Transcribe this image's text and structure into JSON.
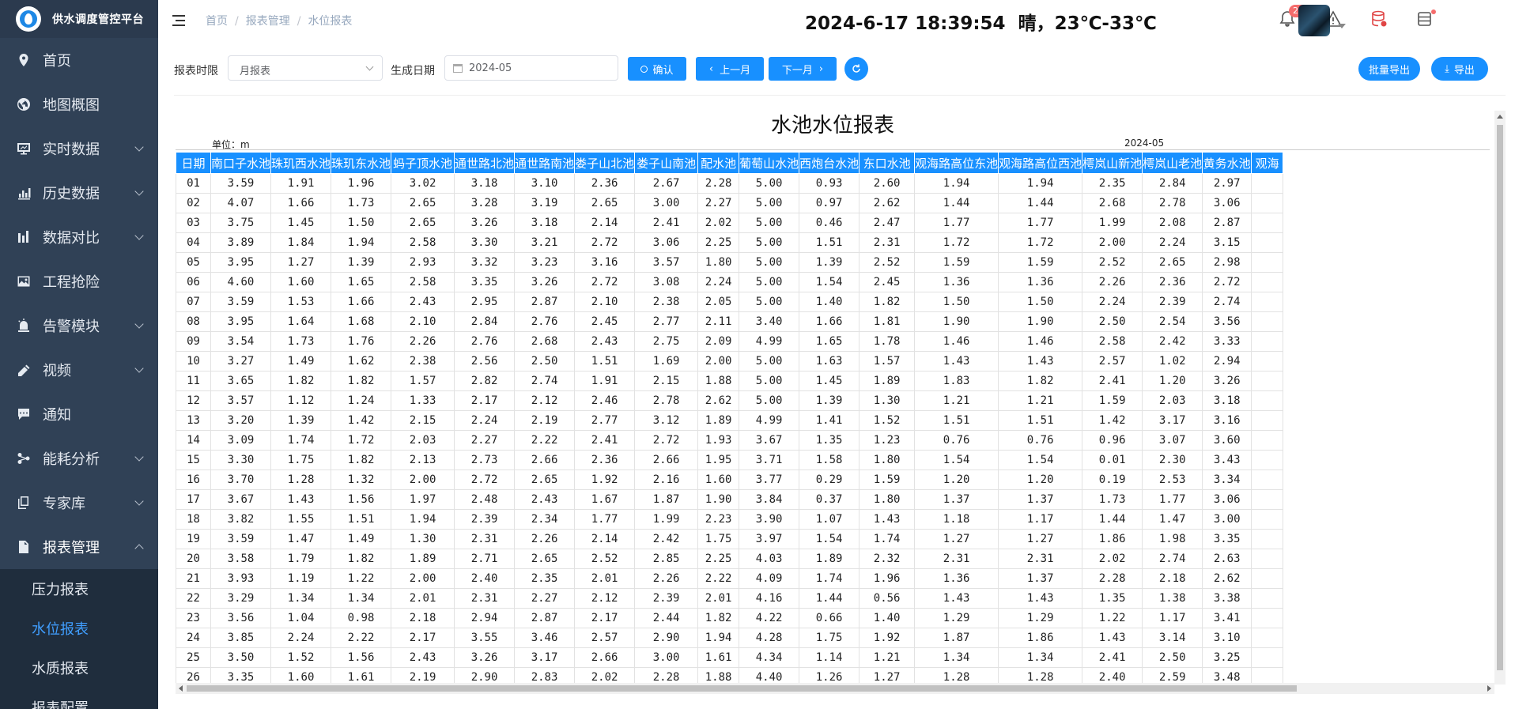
{
  "app": {
    "title": "供水调度管控平台"
  },
  "sidebar": {
    "items": [
      {
        "label": "首页",
        "icon": "location-pin-icon",
        "chevron": false
      },
      {
        "label": "地图概图",
        "icon": "globe-icon",
        "chevron": false
      },
      {
        "label": "实时数据",
        "icon": "monitor-icon",
        "chevron": true
      },
      {
        "label": "历史数据",
        "icon": "bar-chart-icon",
        "chevron": true
      },
      {
        "label": "数据对比",
        "icon": "bar-compare-icon",
        "chevron": true
      },
      {
        "label": "工程抢险",
        "icon": "picture-icon",
        "chevron": false
      },
      {
        "label": "告警模块",
        "icon": "alarm-icon",
        "chevron": true
      },
      {
        "label": "视频",
        "icon": "camera-icon",
        "chevron": true
      },
      {
        "label": "通知",
        "icon": "chat-icon",
        "chevron": false
      },
      {
        "label": "能耗分析",
        "icon": "share-icon",
        "chevron": true
      },
      {
        "label": "专家库",
        "icon": "copy-icon",
        "chevron": true
      },
      {
        "label": "报表管理",
        "icon": "document-icon",
        "chevron": true
      }
    ],
    "sub_items": [
      {
        "label": "压力报表"
      },
      {
        "label": "水位报表"
      },
      {
        "label": "水质报表"
      },
      {
        "label": "报表配置"
      }
    ]
  },
  "header": {
    "breadcrumb": [
      "首页",
      "报表管理",
      "水位报表"
    ],
    "datetime": "2024-6-17 18:39:54",
    "weather": "晴，23℃-33℃",
    "notification_count": "28"
  },
  "toolbar": {
    "period_label": "报表时限",
    "period_value": "月报表",
    "date_label": "生成日期",
    "date_value": "2024-05",
    "confirm": "确认",
    "prev": "上一月",
    "next": "下一月",
    "batch_export": "批量导出",
    "export": "导出"
  },
  "report": {
    "title": "水池水位报表",
    "unit": "单位：m",
    "period": "2024-05",
    "columns": [
      "日期",
      "南口子水池",
      "珠玑西水池",
      "珠玑东水池",
      "蚂子顶水池",
      "通世路北池",
      "通世路南池",
      "娄子山北池",
      "娄子山南池",
      "配水池",
      "葡萄山水池",
      "西炮台水池",
      "东口水池",
      "观海路高位东池",
      "观海路高位西池",
      "樗岚山新池",
      "樗岚山老池",
      "黄务水池",
      "观海"
    ],
    "rows": [
      [
        "01",
        "3.59",
        "1.91",
        "1.96",
        "3.02",
        "3.18",
        "3.10",
        "2.36",
        "2.67",
        "2.28",
        "5.00",
        "0.93",
        "2.60",
        "1.94",
        "1.94",
        "2.35",
        "2.84",
        "2.97",
        ""
      ],
      [
        "02",
        "4.07",
        "1.66",
        "1.73",
        "2.65",
        "3.28",
        "3.19",
        "2.65",
        "3.00",
        "2.27",
        "5.00",
        "0.97",
        "2.62",
        "1.44",
        "1.44",
        "2.68",
        "2.78",
        "3.06",
        ""
      ],
      [
        "03",
        "3.75",
        "1.45",
        "1.50",
        "2.65",
        "3.26",
        "3.18",
        "2.14",
        "2.41",
        "2.02",
        "5.00",
        "0.46",
        "2.47",
        "1.77",
        "1.77",
        "1.99",
        "2.08",
        "2.87",
        ""
      ],
      [
        "04",
        "3.89",
        "1.84",
        "1.94",
        "2.58",
        "3.30",
        "3.21",
        "2.72",
        "3.06",
        "2.25",
        "5.00",
        "1.51",
        "2.31",
        "1.72",
        "1.72",
        "2.00",
        "2.24",
        "3.15",
        ""
      ],
      [
        "05",
        "3.95",
        "1.27",
        "1.39",
        "2.93",
        "3.32",
        "3.23",
        "3.16",
        "3.57",
        "1.80",
        "5.00",
        "1.39",
        "2.52",
        "1.59",
        "1.59",
        "2.52",
        "2.65",
        "2.98",
        ""
      ],
      [
        "06",
        "4.60",
        "1.60",
        "1.65",
        "2.58",
        "3.35",
        "3.26",
        "2.72",
        "3.08",
        "2.24",
        "5.00",
        "1.54",
        "2.45",
        "1.36",
        "1.36",
        "2.26",
        "2.36",
        "2.72",
        ""
      ],
      [
        "07",
        "3.59",
        "1.53",
        "1.66",
        "2.43",
        "2.95",
        "2.87",
        "2.10",
        "2.38",
        "2.05",
        "5.00",
        "1.40",
        "1.82",
        "1.50",
        "1.50",
        "2.24",
        "2.39",
        "2.74",
        ""
      ],
      [
        "08",
        "3.95",
        "1.64",
        "1.68",
        "2.10",
        "2.84",
        "2.76",
        "2.45",
        "2.77",
        "2.11",
        "3.40",
        "1.66",
        "1.81",
        "1.90",
        "1.90",
        "2.50",
        "2.54",
        "3.56",
        ""
      ],
      [
        "09",
        "3.54",
        "1.73",
        "1.76",
        "2.26",
        "2.76",
        "2.68",
        "2.43",
        "2.75",
        "2.09",
        "4.99",
        "1.65",
        "1.78",
        "1.46",
        "1.46",
        "2.58",
        "2.42",
        "3.33",
        ""
      ],
      [
        "10",
        "3.27",
        "1.49",
        "1.62",
        "2.38",
        "2.56",
        "2.50",
        "1.51",
        "1.69",
        "2.00",
        "5.00",
        "1.63",
        "1.57",
        "1.43",
        "1.43",
        "2.57",
        "1.02",
        "2.94",
        ""
      ],
      [
        "11",
        "3.65",
        "1.82",
        "1.82",
        "1.57",
        "2.82",
        "2.74",
        "1.91",
        "2.15",
        "1.88",
        "5.00",
        "1.45",
        "1.89",
        "1.83",
        "1.82",
        "2.41",
        "1.20",
        "3.26",
        ""
      ],
      [
        "12",
        "3.57",
        "1.12",
        "1.24",
        "1.33",
        "2.17",
        "2.12",
        "2.46",
        "2.78",
        "2.62",
        "5.00",
        "1.39",
        "1.30",
        "1.21",
        "1.21",
        "1.59",
        "2.03",
        "3.18",
        ""
      ],
      [
        "13",
        "3.20",
        "1.39",
        "1.42",
        "2.15",
        "2.24",
        "2.19",
        "2.77",
        "3.12",
        "1.89",
        "4.99",
        "1.41",
        "1.52",
        "1.51",
        "1.51",
        "1.42",
        "3.17",
        "3.16",
        ""
      ],
      [
        "14",
        "3.09",
        "1.74",
        "1.72",
        "2.03",
        "2.27",
        "2.22",
        "2.41",
        "2.72",
        "1.93",
        "3.67",
        "1.35",
        "1.23",
        "0.76",
        "0.76",
        "0.96",
        "3.07",
        "3.60",
        ""
      ],
      [
        "15",
        "3.30",
        "1.75",
        "1.82",
        "2.13",
        "2.73",
        "2.66",
        "2.36",
        "2.66",
        "1.95",
        "3.71",
        "1.58",
        "1.80",
        "1.54",
        "1.54",
        "0.01",
        "2.30",
        "3.43",
        ""
      ],
      [
        "16",
        "3.70",
        "1.28",
        "1.32",
        "2.00",
        "2.72",
        "2.65",
        "1.92",
        "2.16",
        "1.60",
        "3.77",
        "0.29",
        "1.59",
        "1.20",
        "1.20",
        "0.19",
        "2.53",
        "3.34",
        ""
      ],
      [
        "17",
        "3.67",
        "1.43",
        "1.56",
        "1.97",
        "2.48",
        "2.43",
        "1.67",
        "1.87",
        "1.90",
        "3.84",
        "0.37",
        "1.80",
        "1.37",
        "1.37",
        "1.73",
        "1.77",
        "3.06",
        ""
      ],
      [
        "18",
        "3.82",
        "1.55",
        "1.51",
        "1.94",
        "2.39",
        "2.34",
        "1.77",
        "1.99",
        "2.23",
        "3.90",
        "1.07",
        "1.43",
        "1.18",
        "1.17",
        "1.44",
        "1.47",
        "3.00",
        ""
      ],
      [
        "19",
        "3.59",
        "1.47",
        "1.49",
        "1.30",
        "2.31",
        "2.26",
        "2.14",
        "2.42",
        "1.75",
        "3.97",
        "1.54",
        "1.74",
        "1.27",
        "1.27",
        "1.86",
        "1.98",
        "3.35",
        ""
      ],
      [
        "20",
        "3.58",
        "1.79",
        "1.82",
        "1.89",
        "2.71",
        "2.65",
        "2.52",
        "2.85",
        "2.25",
        "4.03",
        "1.89",
        "2.32",
        "2.31",
        "2.31",
        "2.02",
        "2.74",
        "2.63",
        ""
      ],
      [
        "21",
        "3.93",
        "1.19",
        "1.22",
        "2.00",
        "2.40",
        "2.35",
        "2.01",
        "2.26",
        "2.22",
        "4.09",
        "1.74",
        "1.96",
        "1.36",
        "1.37",
        "2.28",
        "2.18",
        "2.62",
        ""
      ],
      [
        "22",
        "3.29",
        "1.34",
        "1.34",
        "2.01",
        "2.31",
        "2.27",
        "2.12",
        "2.39",
        "2.01",
        "4.16",
        "1.44",
        "0.56",
        "1.43",
        "1.43",
        "1.35",
        "1.38",
        "3.38",
        ""
      ],
      [
        "23",
        "3.56",
        "1.04",
        "0.98",
        "2.18",
        "2.94",
        "2.87",
        "2.17",
        "2.44",
        "1.82",
        "4.22",
        "0.66",
        "1.40",
        "1.29",
        "1.29",
        "1.22",
        "1.17",
        "3.41",
        ""
      ],
      [
        "24",
        "3.85",
        "2.24",
        "2.22",
        "2.17",
        "3.55",
        "3.46",
        "2.57",
        "2.90",
        "1.94",
        "4.28",
        "1.75",
        "1.92",
        "1.87",
        "1.86",
        "1.43",
        "3.14",
        "3.10",
        ""
      ],
      [
        "25",
        "3.50",
        "1.52",
        "1.56",
        "2.43",
        "3.26",
        "3.17",
        "2.66",
        "3.00",
        "1.61",
        "4.34",
        "1.14",
        "1.21",
        "1.34",
        "1.34",
        "2.41",
        "2.50",
        "3.25",
        ""
      ],
      [
        "26",
        "3.35",
        "1.60",
        "1.61",
        "2.19",
        "2.90",
        "2.83",
        "2.02",
        "2.28",
        "1.88",
        "4.40",
        "1.26",
        "1.27",
        "1.28",
        "1.28",
        "2.40",
        "2.59",
        "3.48",
        ""
      ]
    ]
  }
}
